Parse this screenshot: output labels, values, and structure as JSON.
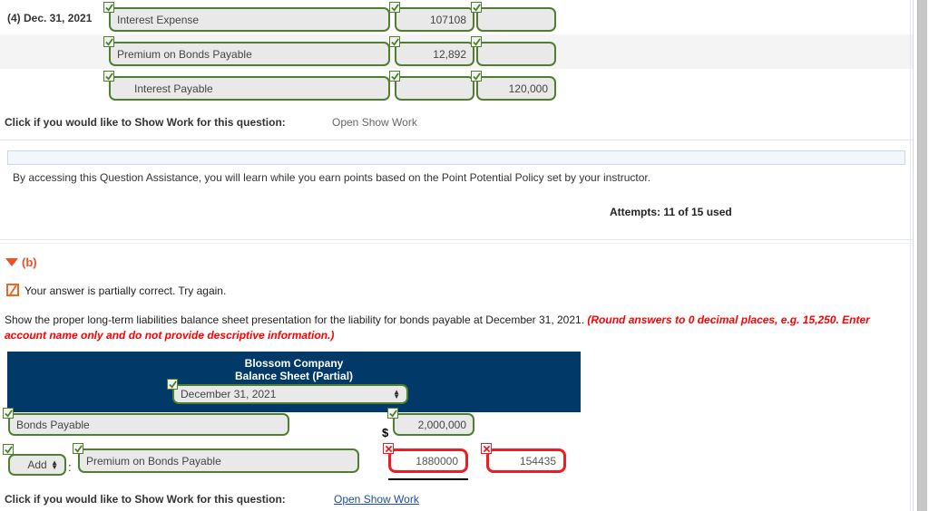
{
  "journal": {
    "rows": [
      {
        "ref": "(4)  Dec. 31, 2021",
        "account": "Interest Expense",
        "debit": "107108",
        "credit": "",
        "indent": false,
        "zebra": false,
        "status": [
          "ok",
          "ok",
          "ok"
        ]
      },
      {
        "ref": "",
        "account": "Premium on Bonds Payable",
        "debit": "12,892",
        "credit": "",
        "indent": false,
        "zebra": true,
        "status": [
          "ok",
          "ok",
          "ok"
        ]
      },
      {
        "ref": "",
        "account": "Interest Payable",
        "debit": "",
        "credit": "120,000",
        "indent": true,
        "zebra": false,
        "status": [
          "ok",
          "ok",
          "ok"
        ]
      }
    ]
  },
  "show_work_top": {
    "label": "Click if you would like to Show Work for this question:",
    "link": "Open Show Work"
  },
  "assistance": {
    "text": "By accessing this Question Assistance, you will learn while you earn points based on the Point Potential Policy set by your instructor."
  },
  "attempts": {
    "text": "Attempts: 11 of 15 used"
  },
  "part_b": {
    "label": "(b)",
    "feedback": "Your answer is partially correct.  Try again.",
    "prompt_plain": "Show the proper long-term liabilities balance sheet presentation for the liability for bonds payable at December 31, 2021. ",
    "prompt_red": "(Round answers to 0 decimal places, e.g. 15,250. Enter account name only and do not provide descriptive information.)"
  },
  "balance_sheet": {
    "company": "Blossom Company",
    "subtitle": "Balance Sheet (Partial)",
    "date_select": "December 31, 2021",
    "rows": [
      {
        "account": "Bonds Payable",
        "amount": "2,000,000",
        "currency_symbol": "$",
        "status_account": "ok",
        "status_amount": "ok"
      },
      {
        "prefix_select": "Add",
        "separator": ":",
        "account": "Premium on Bonds Payable",
        "amount_1": "1880000",
        "amount_2": "154435",
        "status_prefix": "ok",
        "status_account": "ok",
        "status_amount_1": "error",
        "status_amount_2": "error"
      }
    ]
  },
  "show_work_bottom": {
    "label": "Click if you would like to Show Work for this question:",
    "link": "Open Show Work"
  },
  "colors": {
    "navy": "#013a68",
    "green": "#4f7e2f",
    "red": "#f01c22",
    "orange": "#f04e23",
    "link_blue": "#1a4f9c"
  }
}
